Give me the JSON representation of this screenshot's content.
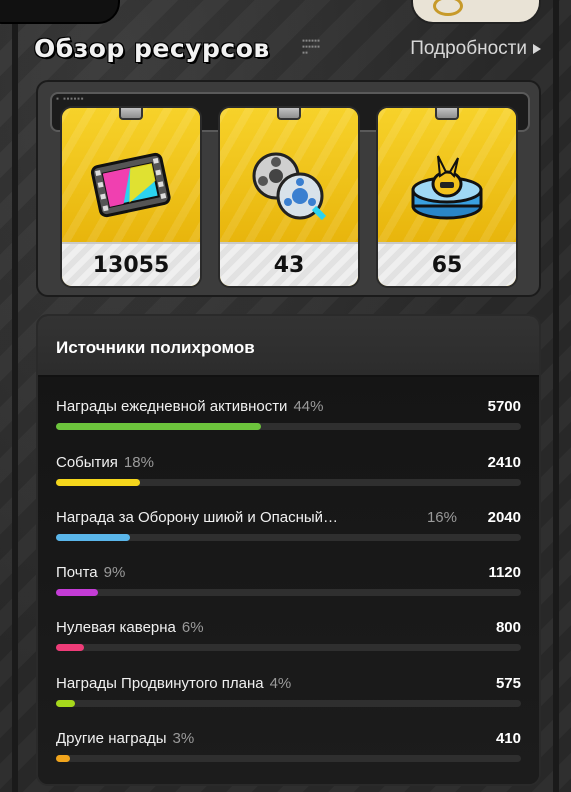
{
  "header": {
    "title": "Обзор ресурсов",
    "details_label": "Подробности"
  },
  "resources": [
    {
      "icon": "film-icon",
      "value": "13055"
    },
    {
      "icon": "film-reels-icon",
      "value": "43"
    },
    {
      "icon": "bangboo-pedestal-icon",
      "value": "65"
    }
  ],
  "sources": {
    "title": "Источники полихромов",
    "rows": [
      {
        "label": "Награды ежедневной активности",
        "percent": "44%",
        "value": "5700",
        "fraction": 0.44,
        "color": "#6cc43c"
      },
      {
        "label": "События",
        "percent": "18%",
        "value": "2410",
        "fraction": 0.18,
        "color": "#f4d61c"
      },
      {
        "label": "Награда за Оборону шиюй и Опасный…",
        "percent": "16%",
        "value": "2040",
        "fraction": 0.16,
        "color": "#5ab6ea"
      },
      {
        "label": "Почта",
        "percent": "9%",
        "value": "1120",
        "fraction": 0.09,
        "color": "#c43cd6"
      },
      {
        "label": "Нулевая каверна",
        "percent": "6%",
        "value": "800",
        "fraction": 0.06,
        "color": "#ee3c78"
      },
      {
        "label": "Награды Продвинутого плана",
        "percent": "4%",
        "value": "575",
        "fraction": 0.04,
        "color": "#a6d81c"
      },
      {
        "label": "Другие награды",
        "percent": "3%",
        "value": "410",
        "fraction": 0.03,
        "color": "#f0a41c"
      }
    ]
  }
}
